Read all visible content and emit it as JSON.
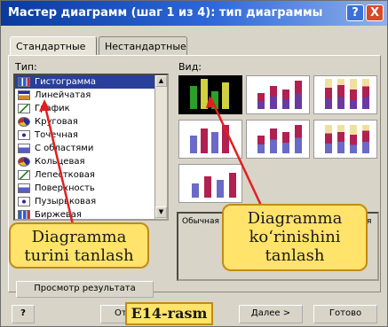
{
  "window": {
    "title": "Мастер диаграмм (шаг 1 из 4): тип диаграммы",
    "help_label": "?",
    "close_label": "X"
  },
  "tabs": [
    {
      "label": "Стандартные"
    },
    {
      "label": "Нестандартные"
    }
  ],
  "type_section": {
    "label": "Тип:",
    "items": [
      {
        "label": "Гистограмма",
        "icon": "bars"
      },
      {
        "label": "Линейчатая",
        "icon": "hbars"
      },
      {
        "label": "График",
        "icon": "line"
      },
      {
        "label": "Круговая",
        "icon": "pie"
      },
      {
        "label": "Точечная",
        "icon": "dots"
      },
      {
        "label": "С областями",
        "icon": "area"
      },
      {
        "label": "Кольцевая",
        "icon": "pie"
      },
      {
        "label": "Лепестковая",
        "icon": "line"
      },
      {
        "label": "Поверхность",
        "icon": "area"
      },
      {
        "label": "Пузырьковая",
        "icon": "dots"
      },
      {
        "label": "Биржевая",
        "icon": "bars"
      }
    ],
    "selected_index": 0
  },
  "view_section": {
    "label": "Вид:",
    "description": "Обычная гистограмма отображает значения"
  },
  "preview_button": "Просмотр результата",
  "buttons": {
    "help_icon": "?",
    "cancel": "Отмена",
    "next": "Далее >",
    "finish": "Готово"
  },
  "annotations": {
    "left_callout": [
      "Diagramma",
      "turini tanlash"
    ],
    "right_callout": [
      "Diagramma",
      "ko‘rinishini",
      "tanlash"
    ],
    "figure_label": "E14-rasm"
  },
  "colors": {
    "title_bar": "#0a3a9c",
    "selection": "#2a3f9a",
    "callout_fill": "#ffe36b",
    "callout_border": "#c48a12",
    "pointer_red": "#e02020"
  }
}
